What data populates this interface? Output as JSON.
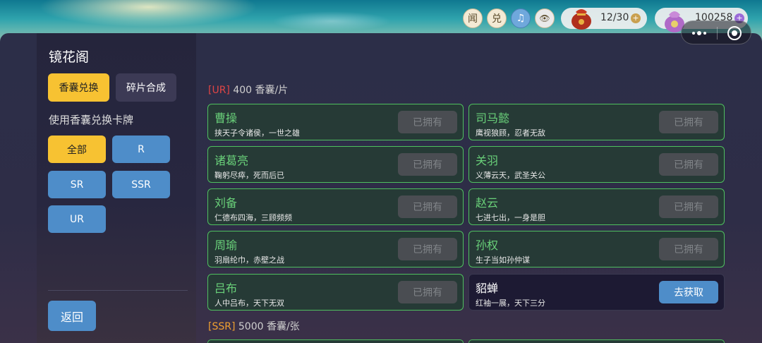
{
  "topbar": {
    "icon_wen": "闻",
    "icon_dui": "兑",
    "icon_music": "♫",
    "icon_eye": "👁",
    "bag_count": "12/30",
    "coin_count": "100258",
    "plus": "+"
  },
  "sidebar": {
    "title": "镜花阁",
    "tab_exchange": "香囊兑换",
    "tab_synthesis": "碎片合成",
    "subtitle": "使用香囊兑换卡牌",
    "filters": [
      "全部",
      "R",
      "SR",
      "SSR",
      "UR"
    ],
    "back": "返回"
  },
  "sections": {
    "ur_tag": "[UR]",
    "ur_price": "400 香囊/片",
    "ssr_tag": "[SSR]",
    "ssr_price": "5000 香囊/张"
  },
  "cards": [
    {
      "name": "曹操",
      "desc": "挟天子令诸侯，一世之雄",
      "button": "已拥有",
      "owned": true
    },
    {
      "name": "司马懿",
      "desc": "鹰视狼顾，忍者无敌",
      "button": "已拥有",
      "owned": true
    },
    {
      "name": "诸葛亮",
      "desc": "鞠躬尽瘁，死而后已",
      "button": "已拥有",
      "owned": true
    },
    {
      "name": "关羽",
      "desc": "义薄云天，武圣关公",
      "button": "已拥有",
      "owned": true
    },
    {
      "name": "刘备",
      "desc": "仁德布四海，三顾频频",
      "button": "已拥有",
      "owned": true
    },
    {
      "name": "赵云",
      "desc": "七进七出，一身是胆",
      "button": "已拥有",
      "owned": true
    },
    {
      "name": "周瑜",
      "desc": "羽扇纶巾，赤壁之战",
      "button": "已拥有",
      "owned": true
    },
    {
      "name": "孙权",
      "desc": "生子当如孙仲谋",
      "button": "已拥有",
      "owned": true
    },
    {
      "name": "吕布",
      "desc": "人中吕布，天下无双",
      "button": "已拥有",
      "owned": true
    },
    {
      "name": "貂蝉",
      "desc": "红袖一展，天下三分",
      "button": "去获取",
      "owned": false
    }
  ]
}
